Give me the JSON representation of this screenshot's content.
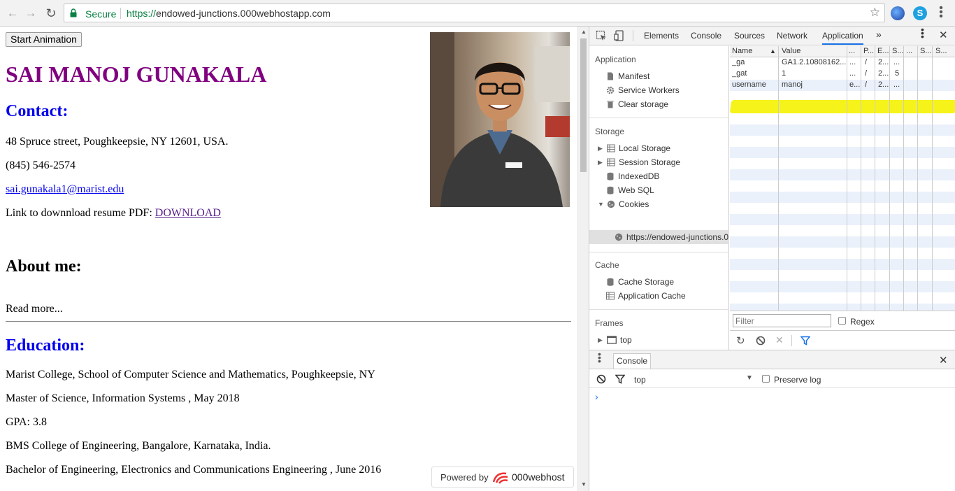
{
  "browser": {
    "secure_label": "Secure",
    "url_proto": "https://",
    "url_rest": "endowed-junctions.000webhostapp.com",
    "star_icon": "star-icon",
    "ext2_label": "S"
  },
  "page": {
    "start_button": "Start Animation",
    "name": "SAI MANOJ GUNAKALA",
    "contact_heading": "Contact:",
    "address": "48 Spruce street, Poughkeepsie, NY 12601, USA.",
    "phone": "(845) 546-2574",
    "email": "sai.gunakala1@marist.edu",
    "resume_label": "Link to downnload resume PDF: ",
    "resume_link": "DOWNLOAD",
    "about_heading": "About me:",
    "read_more": "Read more...",
    "education_heading": "Education:",
    "edu": [
      "Marist College, School of Computer Science and Mathematics, Poughkeepsie, NY",
      "Master of Science, Information Systems , May 2018",
      "GPA: 3.8",
      "BMS College of Engineering, Bangalore, Karnataka, India.",
      "Bachelor of Engineering, Electronics and Communications Engineering , June 2016"
    ],
    "powered_by": "Powered by",
    "powered_brand": "000webhost"
  },
  "devtools": {
    "tabs": [
      "Elements",
      "Console",
      "Sources",
      "Network",
      "Application"
    ],
    "more": "»",
    "sidebar": {
      "application_head": "Application",
      "manifest": "Manifest",
      "service_workers": "Service Workers",
      "clear_storage": "Clear storage",
      "storage_head": "Storage",
      "local_storage": "Local Storage",
      "session_storage": "Session Storage",
      "indexeddb": "IndexedDB",
      "websql": "Web SQL",
      "cookies": "Cookies",
      "cookie_origin": "https://endowed-junctions.0",
      "cache_head": "Cache",
      "cache_storage": "Cache Storage",
      "app_cache": "Application Cache",
      "frames_head": "Frames",
      "frames_top": "top"
    },
    "table": {
      "headers": [
        "Name",
        "Value",
        "...",
        "P...",
        "E...",
        "S...",
        "...",
        "S...",
        "S..."
      ],
      "rows": [
        [
          "_ga",
          "GA1.2.10808162...",
          "...",
          "/",
          "2...",
          "...",
          "",
          "",
          ""
        ],
        [
          "_gat",
          "1",
          "...",
          "/",
          "2...",
          "5",
          "",
          "",
          ""
        ],
        [
          "username",
          "manoj",
          "e...",
          "/",
          "2...",
          "...",
          "",
          "",
          ""
        ]
      ]
    },
    "filter_placeholder": "Filter",
    "regex_label": "Regex",
    "drawer": {
      "tab": "Console",
      "context": "top",
      "preserve_log": "Preserve log",
      "prompt": "›"
    }
  }
}
